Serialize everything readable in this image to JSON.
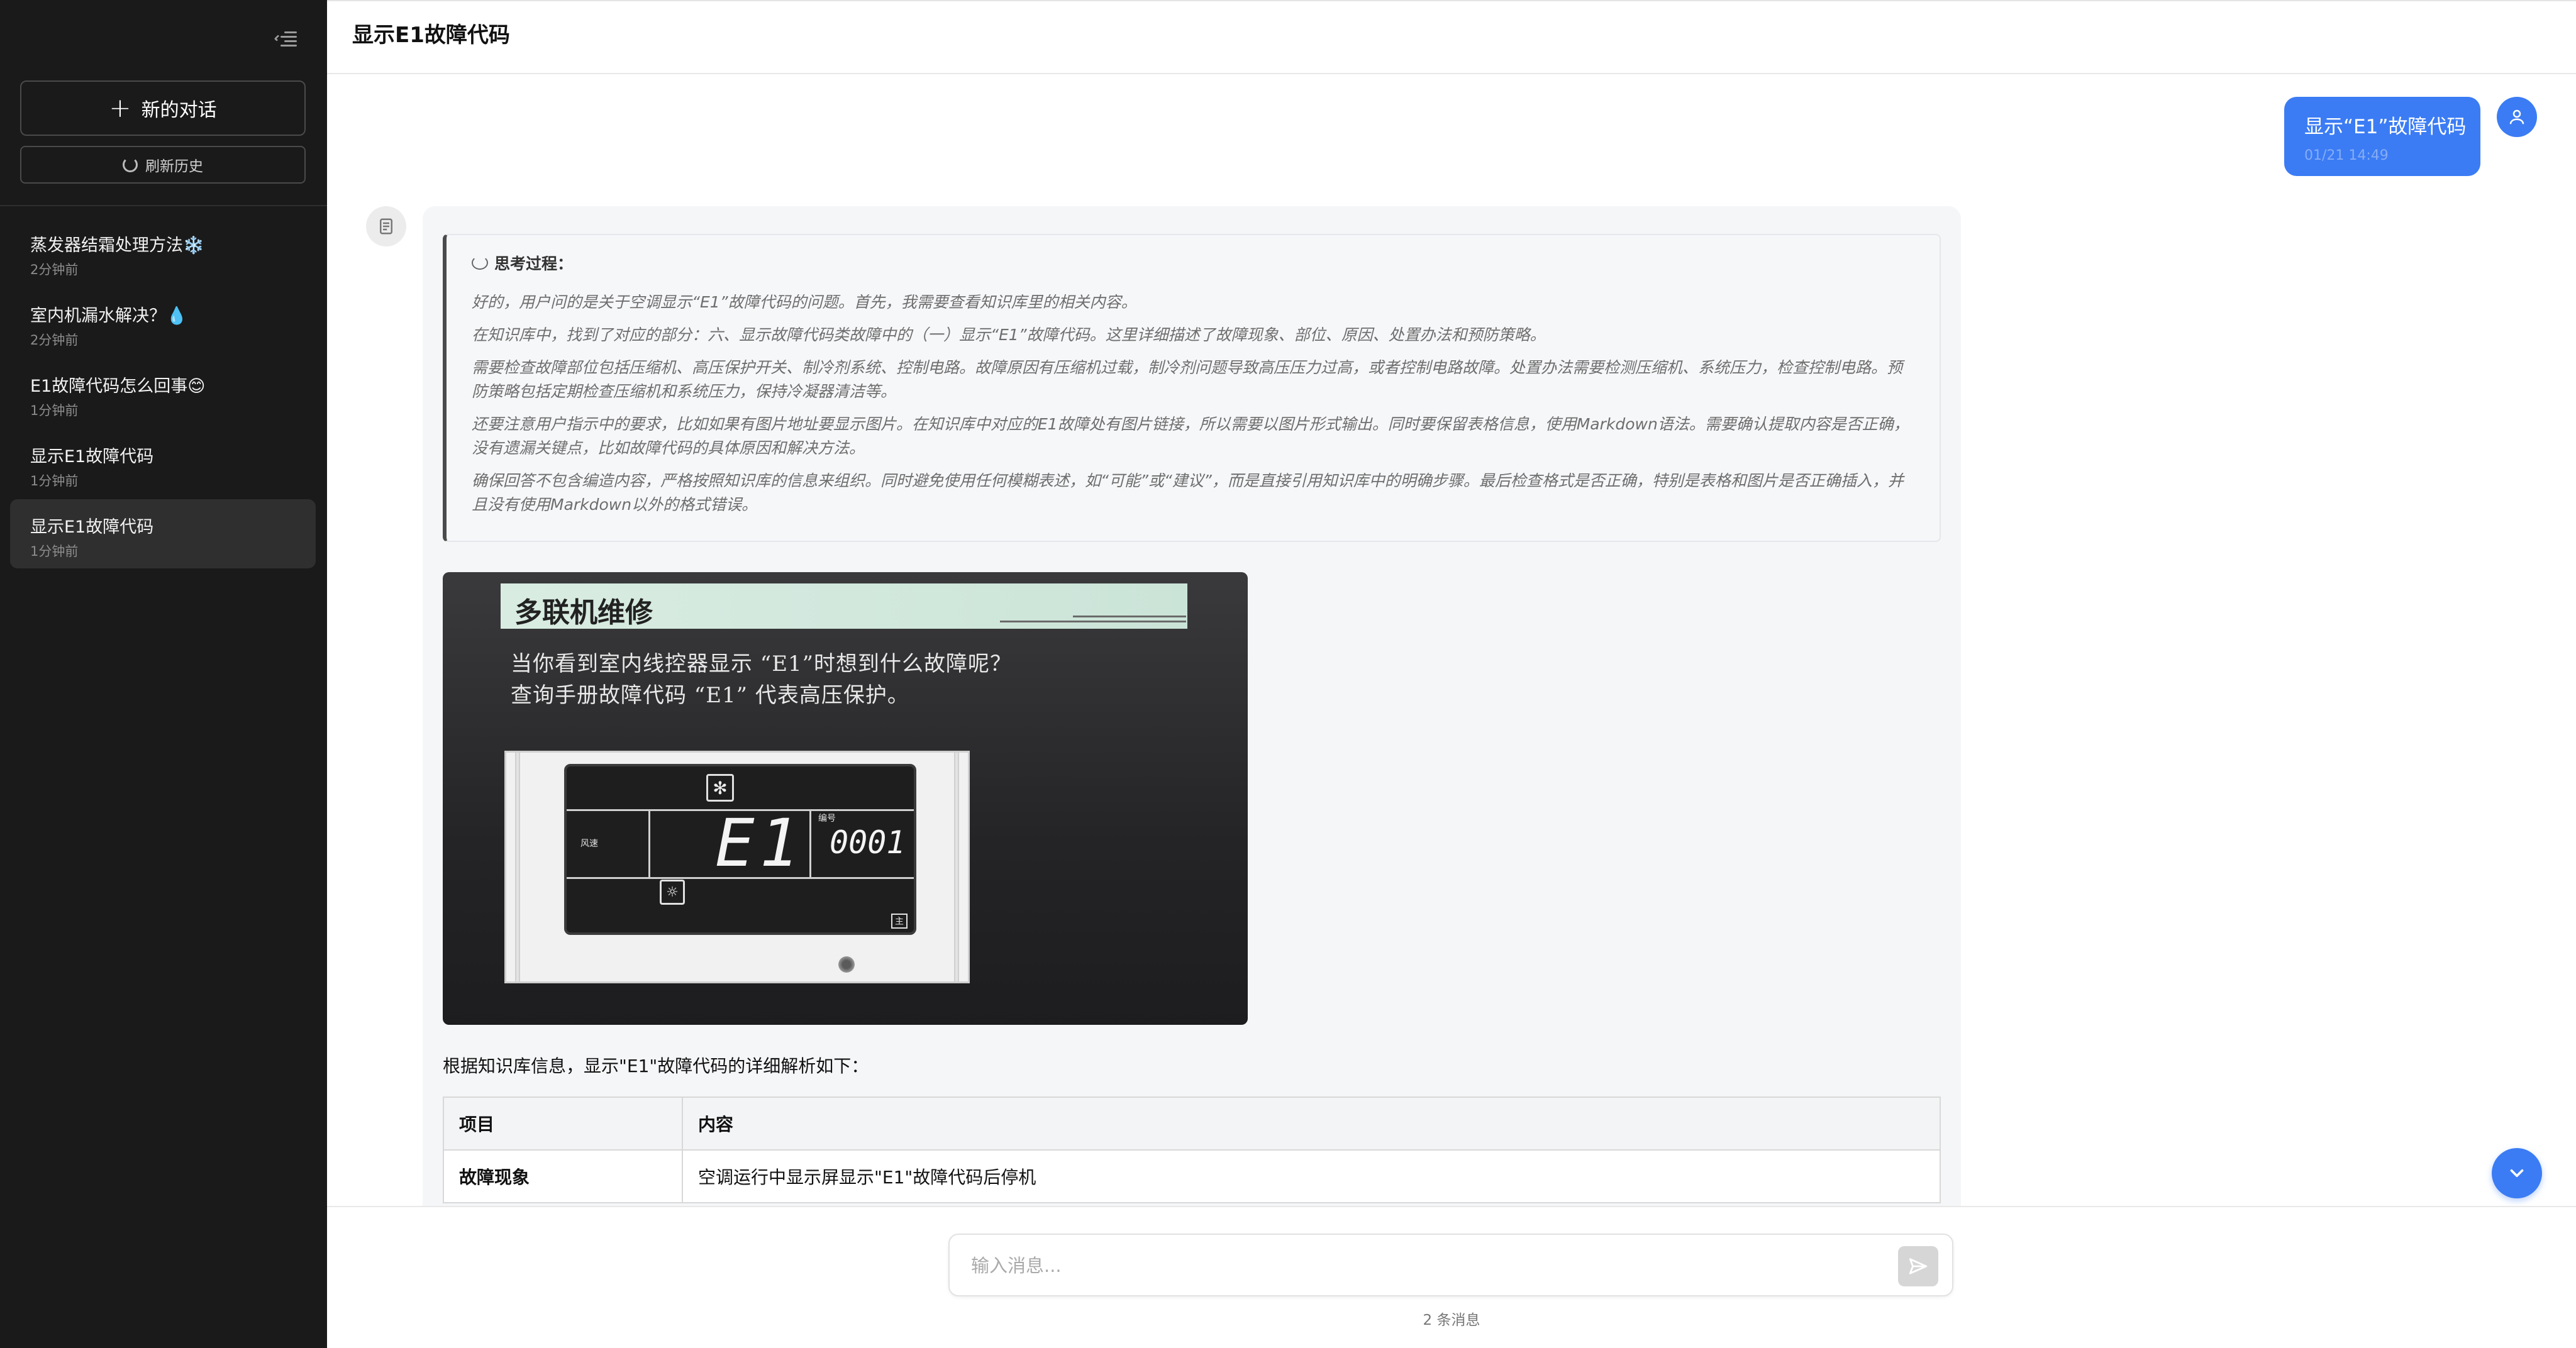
{
  "header": {
    "title": "显示E1故障代码"
  },
  "sidebar": {
    "new_chat_label": "新的对话",
    "refresh_label": "刷新历史",
    "history": [
      {
        "title": "蒸发器结霜处理方法❄️",
        "time": "2分钟前",
        "active": false
      },
      {
        "title": "室内机漏水解决？💧",
        "time": "2分钟前",
        "active": false
      },
      {
        "title": "E1故障代码怎么回事😊",
        "time": "1分钟前",
        "active": false
      },
      {
        "title": "显示E1故障代码",
        "time": "1分钟前",
        "active": false
      },
      {
        "title": "显示E1故障代码",
        "time": "1分钟前",
        "active": true
      }
    ]
  },
  "messages": {
    "user": {
      "text": "显示“E1”故障代码",
      "timestamp": "01/21 14:49"
    },
    "assistant": {
      "thinking_title": "思考过程：",
      "thinking": [
        "好的，用户问的是关于空调显示“E1”故障代码的问题。首先，我需要查看知识库里的相关内容。",
        "在知识库中，找到了对应的部分：六、显示故障代码类故障中的（一）显示“E1”故障代码。这里详细描述了故障现象、部位、原因、处置办法和预防策略。",
        "需要检查故障部位包括压缩机、高压保护开关、制冷剂系统、控制电路。故障原因有压缩机过载，制冷剂问题导致高压压力过高，或者控制电路故障。处置办法需要检测压缩机、系统压力，检查控制电路。预防策略包括定期检查压缩机和系统压力，保持冷凝器清洁等。",
        "还要注意用户指示中的要求，比如如果有图片地址要显示图片。在知识库中对应的E1故障处有图片链接，所以需要以图片形式输出。同时要保留表格信息，使用Markdown语法。需要确认提取内容是否正确，没有遗漏关键点，比如故障代码的具体原因和解决方法。",
        "确保回答不包含编造内容，严格按照知识库的信息来组织。同时避免使用任何模糊表述，如“可能”或“建议”，而是直接引用知识库中的明确步骤。最后检查格式是否正确，特别是表格和图片是否正确插入，并且没有使用Markdown以外的格式错误。"
      ],
      "image": {
        "banner": "多联机维修",
        "line1": "当你看到室内线控器显示 “E1”时想到什么故障呢？",
        "line2": "查询手册故障代码 “E1” 代表高压保护。",
        "lcd_main": "E1",
        "lcd_code": "0001",
        "lcd_label_num": "编号",
        "lcd_label_left": "风速",
        "lcd_label_main": "主"
      },
      "intro": "根据知识库信息，显示\"E1\"故障代码的详细解析如下：",
      "table": {
        "headers": [
          "项目",
          "内容"
        ],
        "rows": [
          [
            "故障现象",
            "空调运行中显示屏显示\"E1\"故障代码后停机"
          ]
        ]
      }
    }
  },
  "input": {
    "placeholder": "输入消息..."
  },
  "footer": {
    "message_count": "2 条消息"
  },
  "colors": {
    "accent": "#3b7cf4",
    "sidebar_bg": "#1a1a1a"
  },
  "icons": {
    "sidebar_toggle": "collapse-menu-icon",
    "new_chat": "plus-icon",
    "refresh": "refresh-icon",
    "user_avatar": "user-icon",
    "bot_avatar": "bot-document-icon",
    "send": "send-arrow-icon",
    "scroll_down": "chevron-down-icon",
    "thinking": "thought-bubble-icon"
  }
}
